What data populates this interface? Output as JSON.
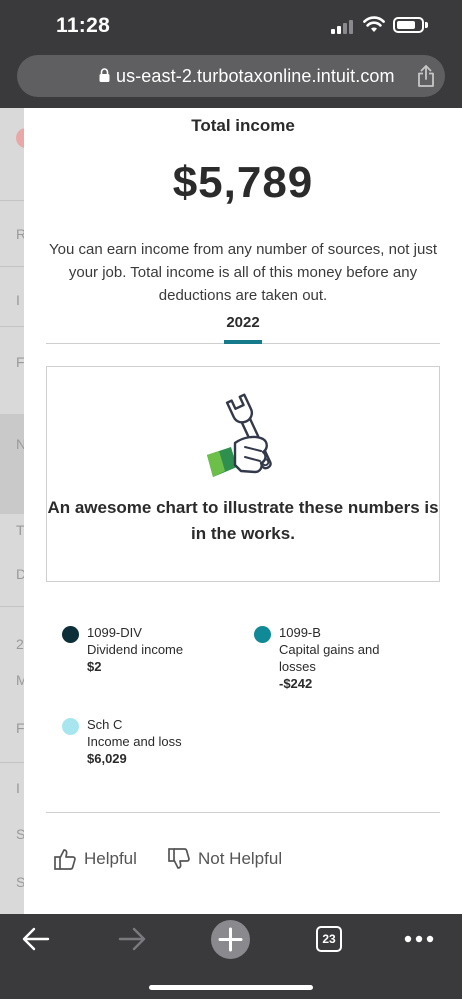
{
  "status_bar": {
    "time": "11:28"
  },
  "browser": {
    "url": "us-east-2.turbotaxonline.intuit.com",
    "tab_count": "23"
  },
  "background_page": {
    "letters": [
      "R",
      "I",
      "F",
      "N",
      "T",
      "D",
      "2",
      "M",
      "F",
      "I",
      "S",
      "S"
    ]
  },
  "card": {
    "title": "Total income",
    "amount": "$5,789",
    "description": "You can earn income from any number of sources, not just your job. Total income is all of this money before any deductions are taken out.",
    "year_tab": "2022",
    "chart_placeholder": "An awesome chart to illustrate these numbers is in the works.",
    "legend": [
      {
        "code": "1099-DIV",
        "description": "Dividend income",
        "value": "$2",
        "color": "#0d2f3a"
      },
      {
        "code": "1099-B",
        "description": "Capital gains and losses",
        "value": "-$242",
        "color": "#108a96"
      },
      {
        "code": "Sch C",
        "description": "Income and loss",
        "value": "$6,029",
        "color": "#a8e6ef"
      }
    ],
    "feedback": {
      "helpful": "Helpful",
      "not_helpful": "Not Helpful"
    }
  },
  "colors": {
    "accent": "#147a8c",
    "chrome": "#3a3a3c"
  },
  "icons": [
    "lock-icon",
    "share-icon",
    "wrench-hand-icon",
    "thumbs-up-icon",
    "thumbs-down-icon",
    "back-arrow-icon",
    "forward-arrow-icon",
    "plus-icon",
    "tabs-icon",
    "more-icon"
  ]
}
